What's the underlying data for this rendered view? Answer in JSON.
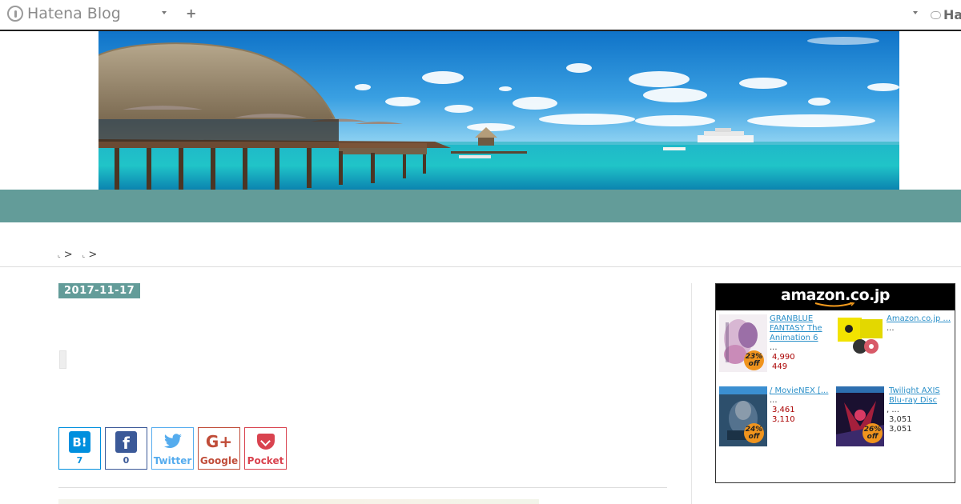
{
  "topbar": {
    "brand": "Hatena Blog",
    "right_brand": "Ha"
  },
  "breadcrumb": {
    "separator": ">"
  },
  "article": {
    "date": "2017-11-17"
  },
  "share": {
    "hatena": {
      "glyph": "B!",
      "count": "7"
    },
    "facebook": {
      "glyph": "f",
      "count": "0"
    },
    "twitter": {
      "label": "Twitter"
    },
    "google": {
      "glyph": "G+",
      "label": "Google"
    },
    "pocket": {
      "label": "Pocket"
    }
  },
  "amazon": {
    "logo": "amazon.co.jp",
    "products": [
      {
        "title": "GRANBLUE FANTASY The Animation 6",
        "dots": "...",
        "price": "4,990",
        "price2": "449",
        "discount": "23%",
        "off": "off"
      },
      {
        "title": "Amazon.co.jp ...",
        "dots": "...",
        "price": "",
        "price2": "",
        "discount": "",
        "off": ""
      },
      {
        "title": "/ MovieNEX [...",
        "dots": "...",
        "price": "3,461",
        "price2": "3,110",
        "discount": "24%",
        "off": "off"
      },
      {
        "title": "Twilight AXIS Blu-ray Disc",
        "dots": ", ...",
        "price": "3,051",
        "price2": "3,051",
        "discount": "26%",
        "off": "off"
      }
    ]
  },
  "colors": {
    "accent": "#639c99",
    "topbar_border": "#222222",
    "hatena_blue": "#008fde",
    "facebook_blue": "#3b5998",
    "twitter_blue": "#55acee",
    "google_red": "#c04c38",
    "pocket_red": "#d9434f"
  },
  "icons": [
    "hatena-logo-icon",
    "chevron-down-icon",
    "plus-icon",
    "cloud-icon",
    "hatena-bookmark-icon",
    "facebook-icon",
    "twitter-bird-icon",
    "google-plus-icon",
    "pocket-icon",
    "amazon-smile-icon"
  ]
}
